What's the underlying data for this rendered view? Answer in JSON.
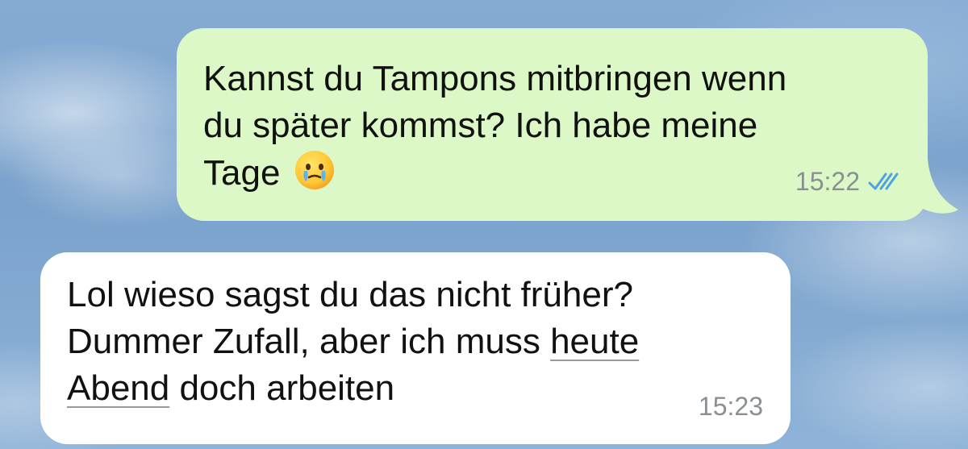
{
  "chat": {
    "messages": [
      {
        "direction": "outgoing",
        "lines": [
          "Kannst du Tampons mitbringen wenn",
          "du später kommst? Ich habe meine",
          "Tage"
        ],
        "emoji": "face-holding-back-tears-icon",
        "time": "15:22",
        "status": "read",
        "bubble_color": "#dcf8c6",
        "check_color": "#4fa3e3"
      },
      {
        "direction": "incoming",
        "line1": "Lol wieso sagst du das nicht früher?",
        "line2_prefix": "Dummer Zufall, aber ich muss ",
        "line2_link": "heute",
        "line3_link": "Abend",
        "line3_suffix": " doch arbeiten",
        "time": "15:23",
        "bubble_color": "#ffffff"
      }
    ]
  }
}
